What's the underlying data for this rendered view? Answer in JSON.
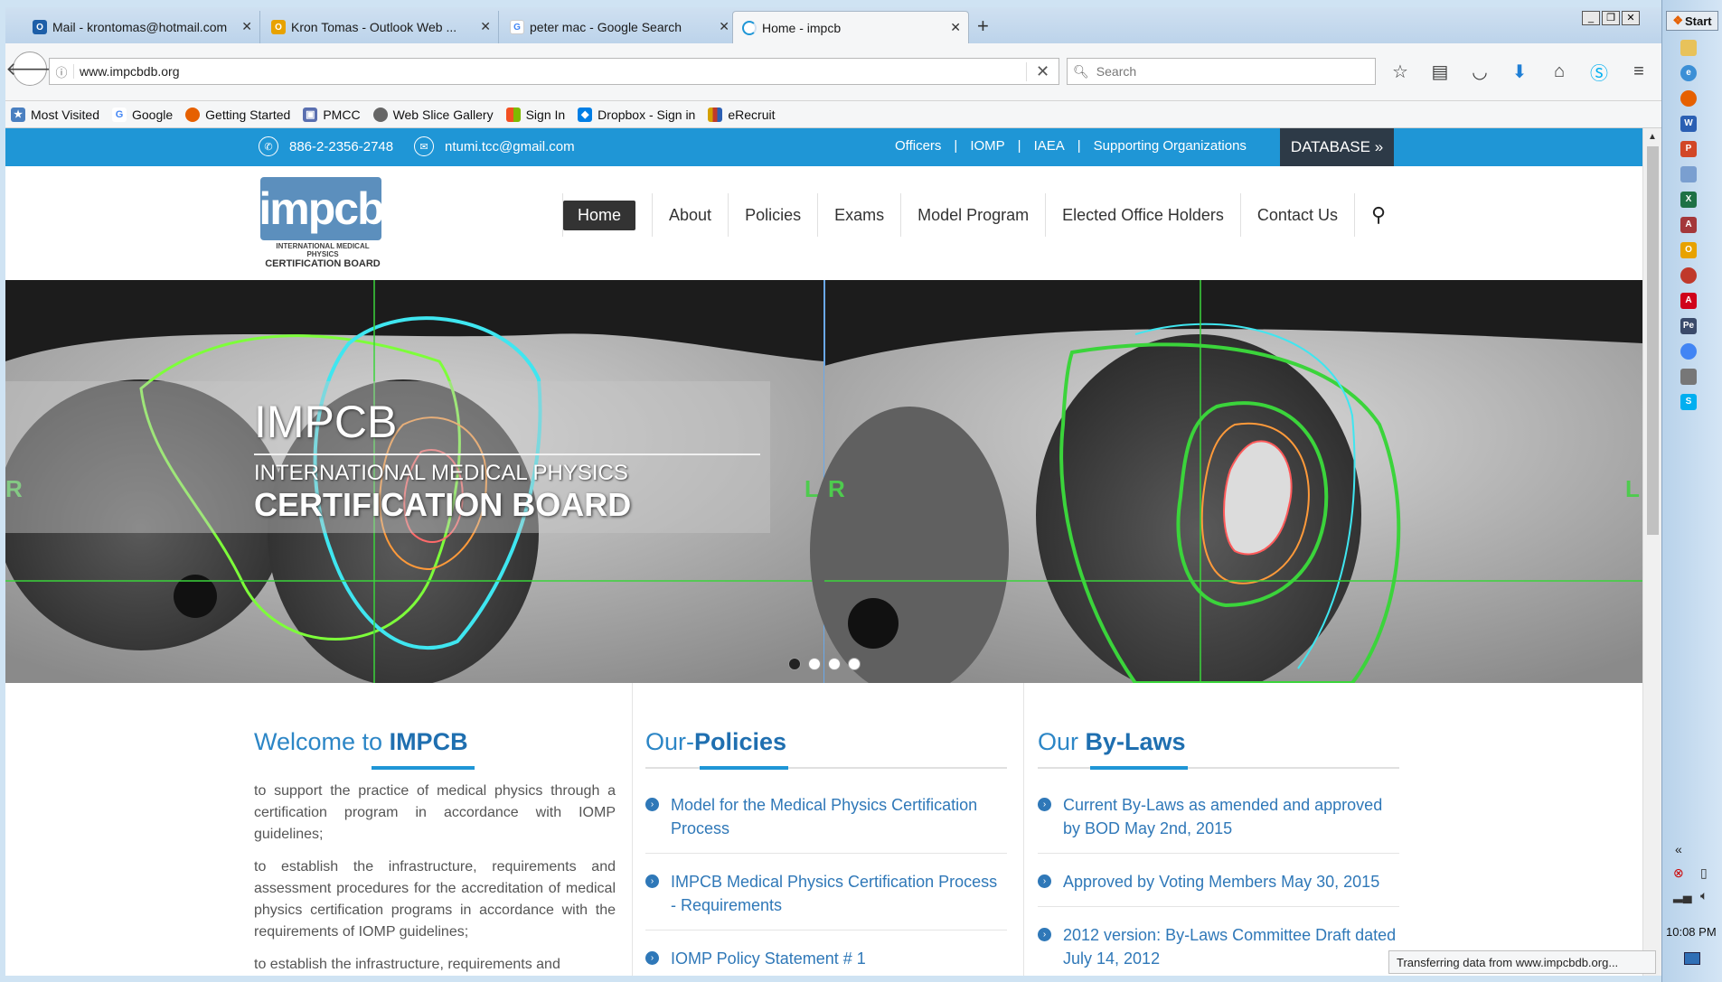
{
  "browser": {
    "tabs": [
      {
        "label": "Mail - krontomas@hotmail.com",
        "icon": "outlook-icon",
        "color": "#1e5fa8"
      },
      {
        "label": "Kron Tomas - Outlook Web ...",
        "icon": "outlook-web-icon",
        "color": "#e8a200"
      },
      {
        "label": "peter mac - Google Search",
        "icon": "google-icon",
        "color": "#4285f4"
      },
      {
        "label": "Home - impcb",
        "icon": "loading-icon",
        "color": "#1f96d6"
      }
    ],
    "url": "www.impcbdb.org",
    "search_placeholder": "Search",
    "bookmarks": [
      {
        "label": "Most Visited",
        "color": "#4a7fc0"
      },
      {
        "label": "Google",
        "color": "#4285f4"
      },
      {
        "label": "Getting Started",
        "color": "#e66000"
      },
      {
        "label": "PMCC",
        "color": "#5a6fb0"
      },
      {
        "label": "Web Slice Gallery",
        "color": "#666666"
      },
      {
        "label": "Sign In",
        "color": "#f25022"
      },
      {
        "label": "Dropbox - Sign in",
        "color": "#007ee5"
      },
      {
        "label": "eRecruit",
        "color": "#d4a000"
      }
    ],
    "status": "Transferring data from www.impcbdb.org..."
  },
  "site": {
    "phone": "886-2-2356-2748",
    "email": "ntumi.tcc@gmail.com",
    "top_links": [
      "Officers",
      "IOMP",
      "IAEA",
      "Supporting Organizations"
    ],
    "database_label": "DATABASE »",
    "logo_text": "impcb",
    "logo_sub1": "INTERNATIONAL MEDICAL PHYSICS",
    "logo_sub2": "CERTIFICATION BOARD",
    "nav": [
      "Home",
      "About",
      "Policies",
      "Exams",
      "Model Program",
      "Elected Office Holders",
      "Contact Us"
    ],
    "slider": {
      "title": "IMPCB",
      "sub1": "INTERNATIONAL MEDICAL PHYSICS",
      "sub2": "CERTIFICATION BOARD",
      "marker_l": "L",
      "marker_r": "R",
      "slides": 4,
      "active_slide": 1
    },
    "welcome": {
      "title_pre": "Welcome to ",
      "title_em": "IMPCB",
      "paragraphs": [
        "to support the practice of medical physics through a certification program in accordance with IOMP guidelines;",
        "to establish the infrastructure, requirements and assessment procedures for the accreditation of medical physics certification programs in accordance with the requirements of IOMP guidelines;",
        "to establish the infrastructure, requirements and"
      ]
    },
    "policies": {
      "title_pre": "Our-",
      "title_em": "Policies",
      "items": [
        "Model for the Medical Physics Certification Process",
        "IMPCB Medical Physics Certification Process - Requirements",
        "IOMP Policy Statement # 1"
      ]
    },
    "bylaws": {
      "title_pre": "Our ",
      "title_em": "By-Laws",
      "items": [
        "Current By-Laws as amended and approved by BOD May 2nd, 2015",
        "Approved by Voting Members May 30, 2015",
        "2012 version: By-Laws Committee Draft dated July 14, 2012"
      ]
    }
  },
  "taskbar": {
    "start_label": "Start",
    "clock": "10:08 PM",
    "tray_arrow": "«",
    "apps": [
      {
        "name": "folder",
        "color": "#e8c25a"
      },
      {
        "name": "ie",
        "color": "#3b8fd6"
      },
      {
        "name": "firefox",
        "color": "#e66000"
      },
      {
        "name": "word",
        "color": "#2b5fb3"
      },
      {
        "name": "powerpoint",
        "color": "#d24726"
      },
      {
        "name": "app",
        "color": "#7a9fd0"
      },
      {
        "name": "excel",
        "color": "#1e7145"
      },
      {
        "name": "access",
        "color": "#a4373a"
      },
      {
        "name": "outlook",
        "color": "#e8a200"
      },
      {
        "name": "app2",
        "color": "#c0392b"
      },
      {
        "name": "acrobat",
        "color": "#d0021b"
      },
      {
        "name": "pe",
        "color": "#3a4a6a"
      },
      {
        "name": "chrome",
        "color": "#4285f4"
      },
      {
        "name": "tool",
        "color": "#777777"
      },
      {
        "name": "skype",
        "color": "#00aff0"
      }
    ]
  }
}
